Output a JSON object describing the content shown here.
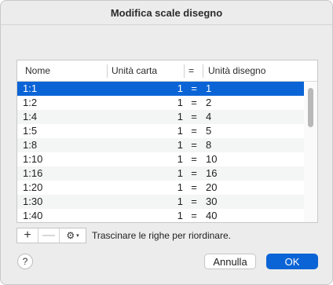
{
  "window": {
    "title": "Modifica scale disegno"
  },
  "table": {
    "columns": {
      "name": "Nome",
      "paper": "Unità carta",
      "equals": "=",
      "drawing": "Unità disegno"
    },
    "rows": [
      {
        "name": "1:1",
        "paper": "1",
        "eq": "=",
        "drawing": "1",
        "selected": true
      },
      {
        "name": "1:2",
        "paper": "1",
        "eq": "=",
        "drawing": "2"
      },
      {
        "name": "1:4",
        "paper": "1",
        "eq": "=",
        "drawing": "4"
      },
      {
        "name": "1:5",
        "paper": "1",
        "eq": "=",
        "drawing": "5"
      },
      {
        "name": "1:8",
        "paper": "1",
        "eq": "=",
        "drawing": "8"
      },
      {
        "name": "1:10",
        "paper": "1",
        "eq": "=",
        "drawing": "10"
      },
      {
        "name": "1:16",
        "paper": "1",
        "eq": "=",
        "drawing": "16"
      },
      {
        "name": "1:20",
        "paper": "1",
        "eq": "=",
        "drawing": "20"
      },
      {
        "name": "1:30",
        "paper": "1",
        "eq": "=",
        "drawing": "30"
      },
      {
        "name": "1:40",
        "paper": "1",
        "eq": "=",
        "drawing": "40"
      }
    ]
  },
  "toolbar": {
    "add_symbol": "+",
    "remove_symbol": "—",
    "action_symbol": "⚙",
    "action_caret": "▾"
  },
  "hint": "Trascinare le righe per riordinare.",
  "buttons": {
    "help": "?",
    "cancel": "Annulla",
    "ok": "OK"
  },
  "colors": {
    "accent": "#0a64d6",
    "window_bg": "#ececec"
  }
}
